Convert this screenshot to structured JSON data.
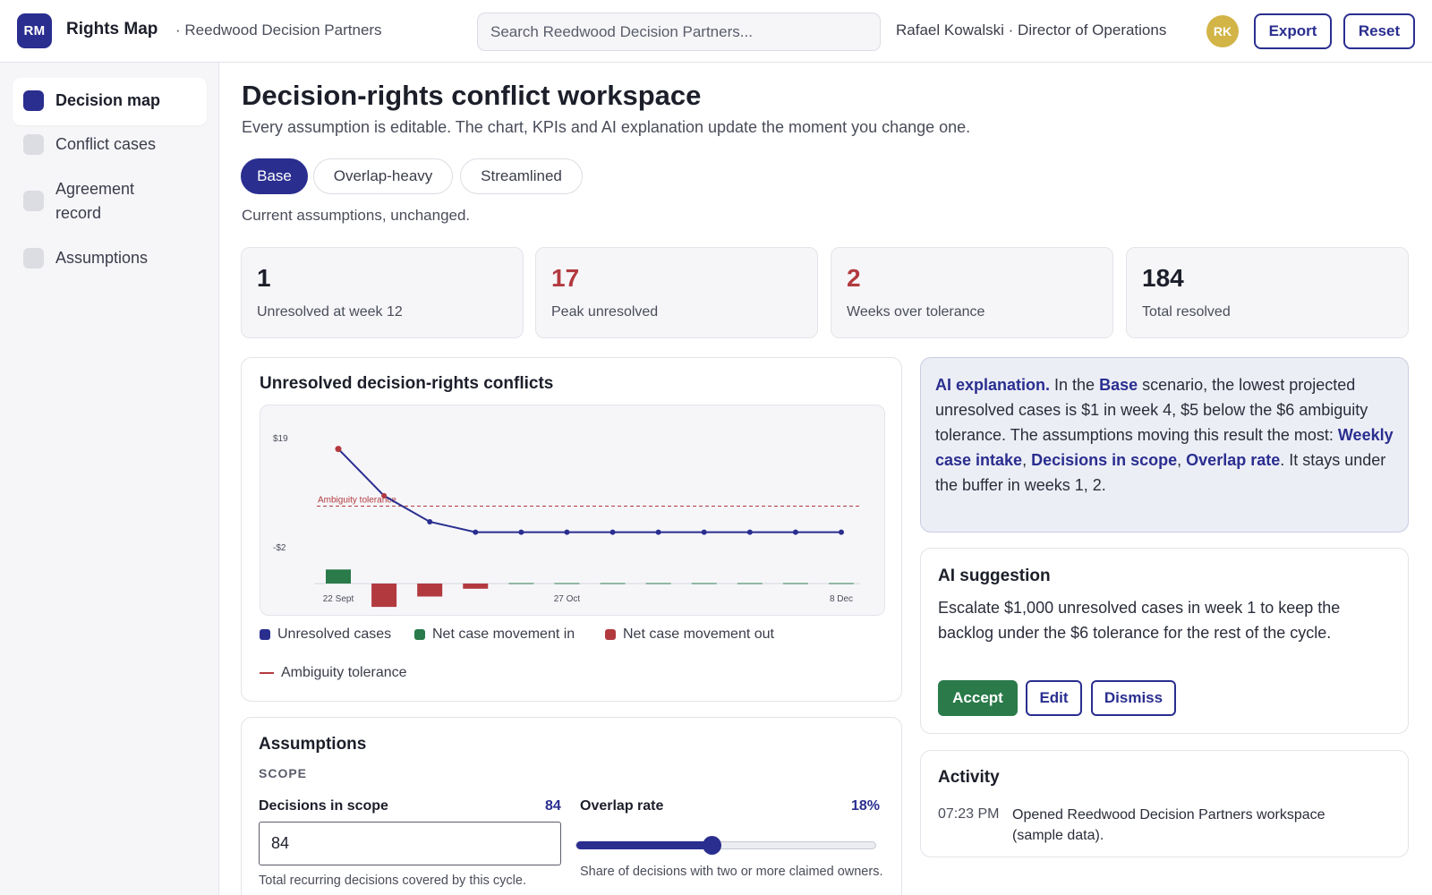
{
  "header": {
    "logo": "RM",
    "app_title": "Rights Map",
    "org": "· Reedwood Decision Partners",
    "search_placeholder": "Search Reedwood Decision Partners...",
    "user": "Rafael Kowalski · Director of Operations",
    "avatar": "RK",
    "export_label": "Export",
    "reset_label": "Reset"
  },
  "sidebar": {
    "items": [
      {
        "label": "Decision map",
        "active": true
      },
      {
        "label": "Conflict cases",
        "active": false
      },
      {
        "label": "Agreement record",
        "active": false
      },
      {
        "label": "Assumptions",
        "active": false
      }
    ]
  },
  "main": {
    "title": "Decision-rights conflict workspace",
    "subtitle": "Every assumption is editable. The chart, KPIs and AI explanation update the moment you change one.",
    "scenarios": [
      "Base",
      "Overlap-heavy",
      "Streamlined"
    ],
    "active_scenario": "Base",
    "scenario_note": "Current assumptions, unchanged."
  },
  "kpis": [
    {
      "value": "1",
      "label": "Unresolved at week 12",
      "alert": false
    },
    {
      "value": "17",
      "label": "Peak unresolved",
      "alert": true
    },
    {
      "value": "2",
      "label": "Weeks over tolerance",
      "alert": true
    },
    {
      "value": "184",
      "label": "Total resolved",
      "alert": false
    }
  ],
  "chart_card": {
    "title": "Unresolved decision-rights conflicts",
    "legend": {
      "unresolved": "Unresolved cases",
      "in": "Net case movement in",
      "out": "Net case movement out",
      "tolerance": "Ambiguity tolerance"
    }
  },
  "chart_data": {
    "type": "line",
    "title": "Unresolved decision-rights conflicts",
    "x": [
      "22 Sept",
      "29 Sept",
      "6 Oct",
      "13 Oct",
      "20 Oct",
      "27 Oct",
      "3 Nov",
      "10 Nov",
      "17 Nov",
      "24 Nov",
      "1 Dec",
      "8 Dec"
    ],
    "x_tick_labels": [
      "22 Sept",
      "27 Oct",
      "8 Dec"
    ],
    "y_tick_labels": [
      "$19",
      "-$2"
    ],
    "ylim": [
      -2,
      19
    ],
    "tolerance_label": "Ambiguity tolerance",
    "tolerance": 6,
    "series": [
      {
        "name": "Unresolved cases",
        "kind": "line",
        "color": "#2a2e8f",
        "values": [
          17,
          8,
          3,
          1,
          1,
          1,
          1,
          1,
          1,
          1,
          1,
          1
        ]
      },
      {
        "name": "Net case movement in",
        "kind": "bar",
        "color": "#2a7a4a",
        "values": [
          3,
          0,
          0,
          0,
          0,
          0,
          0,
          0,
          0,
          0,
          0,
          0
        ]
      },
      {
        "name": "Net case movement out",
        "kind": "bar",
        "color": "#b23a3f",
        "values": [
          0,
          -9,
          -5,
          -2,
          0,
          0,
          0,
          0,
          0,
          0,
          0,
          0
        ]
      }
    ],
    "grid": false
  },
  "ai_explanation": {
    "lead": "AI explanation.",
    "t1": " In the ",
    "scenario": "Base",
    "t2": " scenario, the lowest projected unresolved cases is $1 in week 4, $5 below the $6 ambiguity tolerance. The assumptions moving this result the most: ",
    "d1": "Weekly case intake",
    "sep1": ", ",
    "d2": "Decisions in scope",
    "sep2": ", ",
    "d3": "Overlap rate",
    "t3": ". It stays under the buffer in weeks 1, 2."
  },
  "ai_suggestion": {
    "title": "AI suggestion",
    "text": "Escalate $1,000 unresolved cases in week 1 to keep the backlog under the $6 tolerance for the rest of the cycle.",
    "accept": "Accept",
    "edit": "Edit",
    "dismiss": "Dismiss"
  },
  "activity": {
    "title": "Activity",
    "items": [
      {
        "time": "07:23 PM",
        "text": "Opened Reedwood Decision Partners workspace (sample data)."
      }
    ]
  },
  "assumptions": {
    "title": "Assumptions",
    "section": "SCOPE",
    "decisions_label": "Decisions in scope",
    "decisions_value": "84",
    "decisions_input": "84",
    "decisions_help": "Total recurring decisions covered by this cycle.",
    "overlap_label": "Overlap rate",
    "overlap_value": "18%",
    "overlap_fraction": 0.45,
    "overlap_help": "Share of decisions with two or more claimed owners."
  },
  "colors": {
    "accent": "#2a2e8f",
    "alert": "#b23a3f",
    "positive": "#2a7a4a",
    "avatar": "#d2b447"
  }
}
